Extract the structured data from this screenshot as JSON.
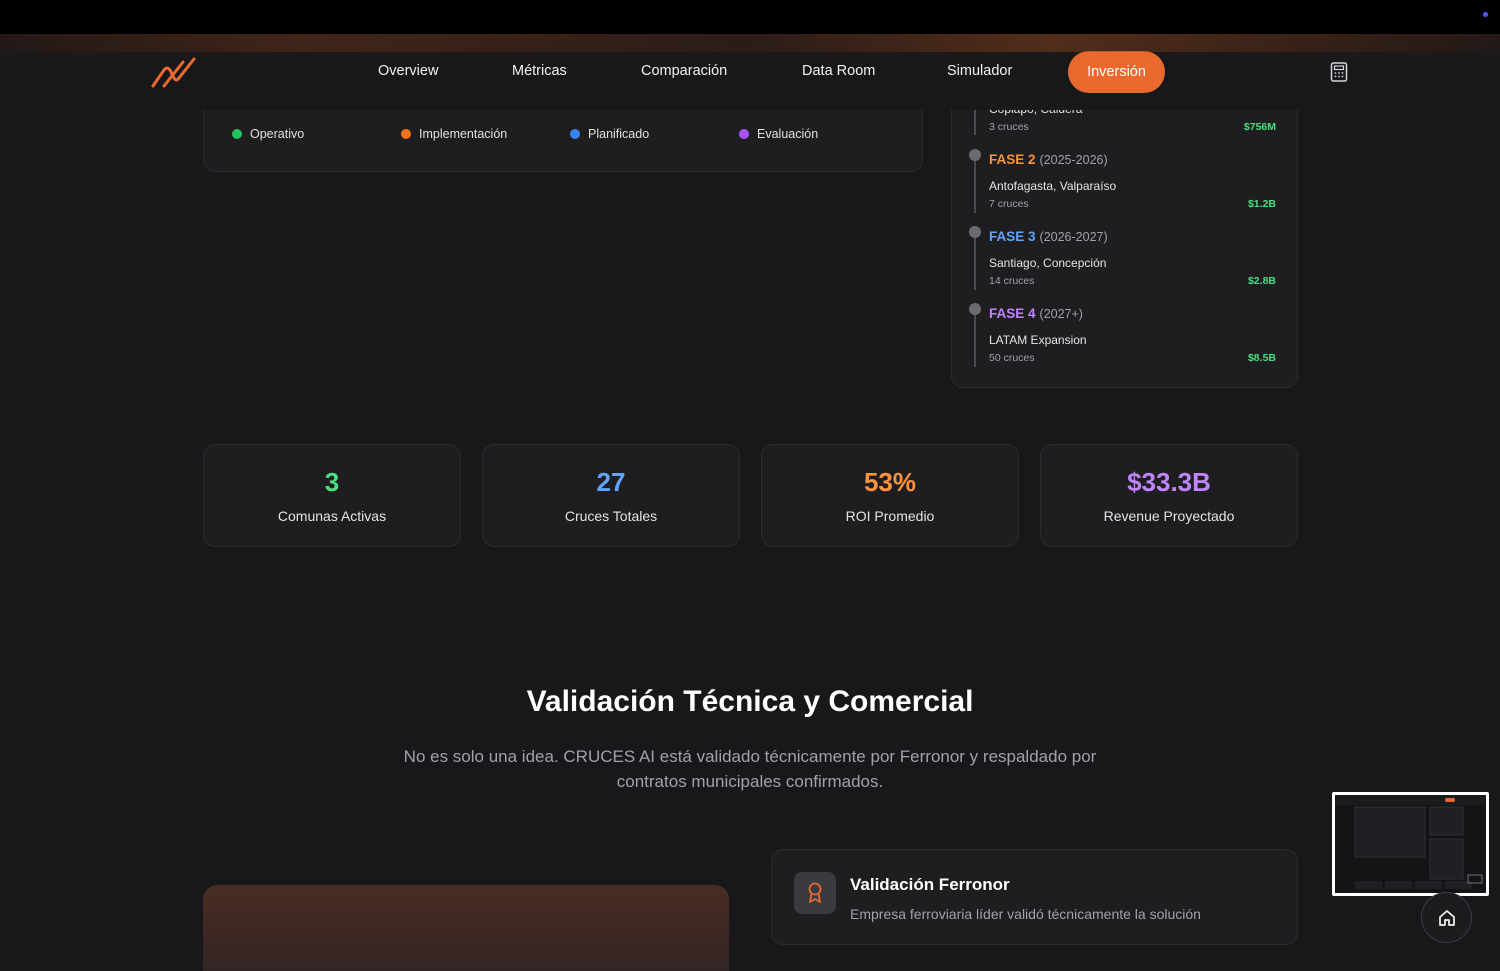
{
  "nav": {
    "items": [
      "Overview",
      "Métricas",
      "Comparación",
      "Data Room",
      "Simulador"
    ],
    "cta": "Inversión"
  },
  "legend": [
    {
      "label": "Operativo",
      "color": "#22c55e"
    },
    {
      "label": "Implementación",
      "color": "#f97316"
    },
    {
      "label": "Planificado",
      "color": "#3b82f6"
    },
    {
      "label": "Evaluación",
      "color": "#a855f7"
    }
  ],
  "phases": {
    "partial": {
      "location": "Copiapó, Caldera",
      "crossings": "3 cruces",
      "amount": "$756M"
    },
    "items": [
      {
        "name": "FASE 2",
        "years": "(2025-2026)",
        "location": "Antofagasta, Valparaíso",
        "crossings": "7 cruces",
        "amount": "$1.2B",
        "color": "#fb923c"
      },
      {
        "name": "FASE 3",
        "years": "(2026-2027)",
        "location": "Santiago, Concepción",
        "crossings": "14 cruces",
        "amount": "$2.8B",
        "color": "#60a5fa"
      },
      {
        "name": "FASE 4",
        "years": "(2027+)",
        "location": "LATAM Expansion",
        "crossings": "50 cruces",
        "amount": "$8.5B",
        "color": "#c084fc"
      }
    ]
  },
  "stats": [
    {
      "value": "3",
      "label": "Comunas Activas",
      "color": "#4ade80"
    },
    {
      "value": "27",
      "label": "Cruces Totales",
      "color": "#60a5fa"
    },
    {
      "value": "53%",
      "label": "ROI Promedio",
      "color": "#fb923c"
    },
    {
      "value": "$33.3B",
      "label": "Revenue Proyectado",
      "color": "#c084fc"
    }
  ],
  "section": {
    "title": "Validación Técnica y Comercial",
    "subtitle": "No es solo una idea. CRUCES AI está validado técnicamente por Ferronor y respaldado por contratos municipales confirmados."
  },
  "feature": {
    "title": "Validación Ferronor",
    "description": "Empresa ferroviaria líder validó técnicamente la solución",
    "icon": "award-icon"
  },
  "icons": {
    "logo": "logo-icon",
    "calculator": "calculator-icon",
    "home": "home-icon"
  }
}
